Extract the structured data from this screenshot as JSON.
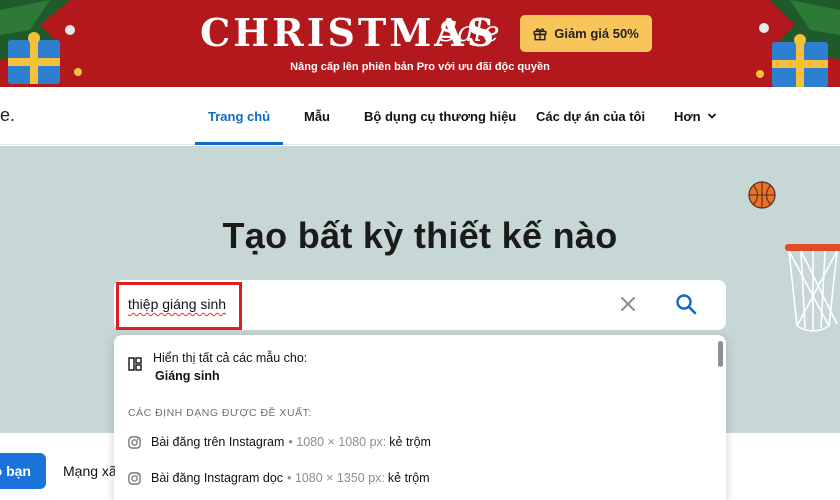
{
  "promo": {
    "title": "CHRISTMAS",
    "title_script": "Sale",
    "cta_label": "Giảm giá 50%",
    "cta_icon": "gift-icon",
    "subtitle": "Nâng cấp lên phiên bản Pro với ưu đãi độc quyền",
    "colors": {
      "background": "#b3181c",
      "cta": "#f8c55b"
    }
  },
  "nav": {
    "logo_fragment": "e.",
    "items": [
      {
        "label": "Trang chủ",
        "active": true
      },
      {
        "label": "Mẫu"
      },
      {
        "label": "Bộ dụng cụ thương hiệu"
      },
      {
        "label": "Các dự án của tôi"
      },
      {
        "label": "Hơn",
        "icon": "chevron-down-icon"
      }
    ],
    "accent": "#0d6bc4"
  },
  "hero": {
    "title": "Tạo bất kỳ thiết kế nào",
    "background": "#c6d7d6"
  },
  "search": {
    "value": "thiệp giáng sinh",
    "clear_icon": "close-icon",
    "search_icon": "search-icon"
  },
  "dropdown": {
    "show_all_line1": "Hiển thị tất cả các mẫu cho:",
    "show_all_line2": "Giáng sinh",
    "section_heading": "CÁC ĐỊNH DẠNG ĐƯỢC ĐỀ XUẤT:",
    "suggestions": [
      {
        "name": "Bài đăng trên Instagram",
        "meta": "• 1080 × 1080 px:",
        "keyword": "kẻ trộm",
        "icon": "instagram-icon"
      },
      {
        "name": "Bài đăng Instagram dọc",
        "meta": "• 1080 × 1350 px:",
        "keyword": "kẻ trộm",
        "icon": "instagram-icon"
      }
    ]
  },
  "bottom": {
    "chip_blue_label": "o bạn",
    "chip_plain_label": "Mạng xã"
  }
}
